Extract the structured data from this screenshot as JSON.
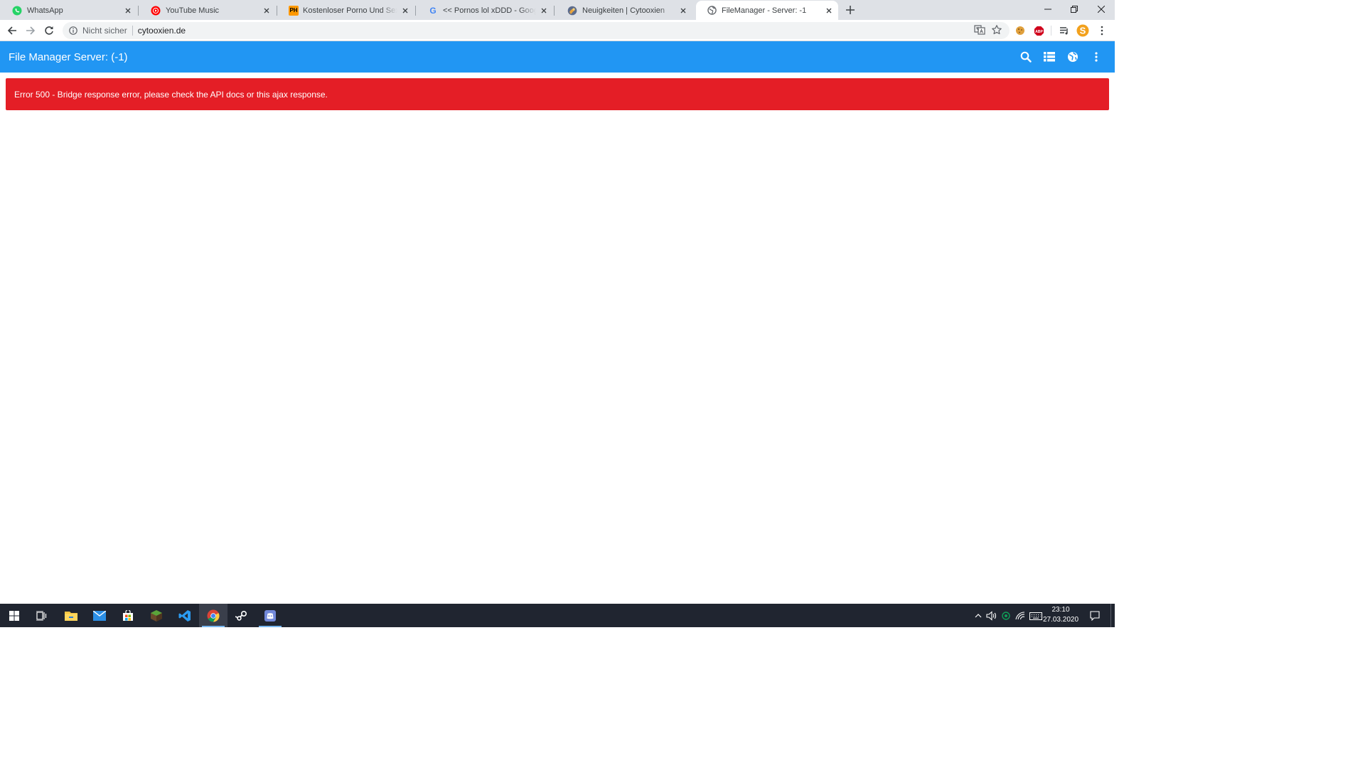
{
  "browser": {
    "tabs": [
      {
        "title": "WhatsApp",
        "icon": "whatsapp-icon"
      },
      {
        "title": "YouTube Music",
        "icon": "youtube-music-icon"
      },
      {
        "title": "Kostenloser Porno Und Sexvideos",
        "icon": "pornhub-icon",
        "icon_text": "PH"
      },
      {
        "title": "<< Pornos lol xDDD - Google-Suche",
        "icon": "google-icon",
        "icon_text": "G"
      },
      {
        "title": "Neuigkeiten | Cytooxien",
        "icon": "cytooxien-icon"
      },
      {
        "title": "FileManager - Server: -1",
        "icon": "globe-icon",
        "active": true
      }
    ],
    "address": {
      "security_label": "Nicht sicher",
      "url": "cytooxien.de"
    }
  },
  "app": {
    "title": "File Manager Server: (-1)",
    "header_color": "#2196f3",
    "actions": [
      "search-icon",
      "list-view-icon",
      "language-icon",
      "more-vert-icon"
    ]
  },
  "error": {
    "message": "Error 500 - Bridge response error, please check the API docs or this ajax response.",
    "color": "#e41e26"
  },
  "taskbar": {
    "apps": [
      "file-explorer-icon",
      "mail-icon",
      "store-icon",
      "minecraft-icon",
      "vscode-icon",
      "chrome-icon",
      "steam-icon",
      "discord-icon"
    ],
    "clock": {
      "time": "23:10",
      "date": "27.03.2020"
    }
  }
}
